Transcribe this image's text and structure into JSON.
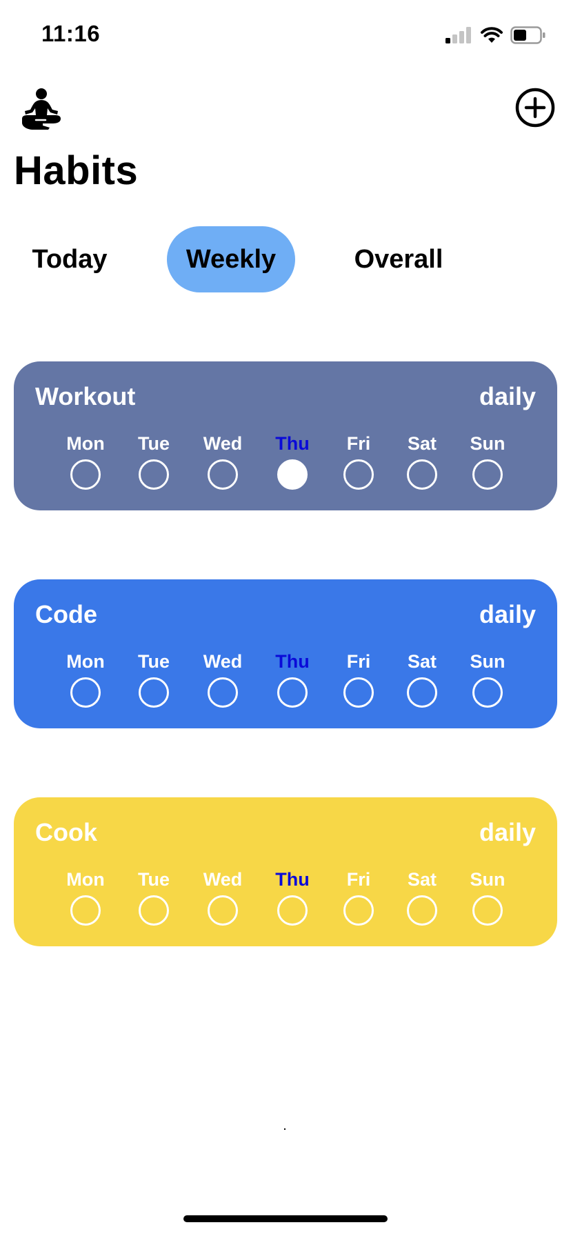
{
  "status_bar": {
    "time": "11:16"
  },
  "header": {
    "title": "Habits",
    "left_icon": "meditation-icon",
    "right_icon": "plus-circle-icon"
  },
  "tabs": [
    {
      "label": "Today",
      "selected": false
    },
    {
      "label": "Weekly",
      "selected": true
    },
    {
      "label": "Overall",
      "selected": false
    }
  ],
  "today_day": "Thu",
  "habits": [
    {
      "name": "Workout",
      "frequency": "daily",
      "color": "#6476a5",
      "days": [
        {
          "label": "Mon",
          "done": false
        },
        {
          "label": "Tue",
          "done": false
        },
        {
          "label": "Wed",
          "done": false
        },
        {
          "label": "Thu",
          "done": true
        },
        {
          "label": "Fri",
          "done": false
        },
        {
          "label": "Sat",
          "done": false
        },
        {
          "label": "Sun",
          "done": false
        }
      ]
    },
    {
      "name": "Code",
      "frequency": "daily",
      "color": "#3a78e8",
      "days": [
        {
          "label": "Mon",
          "done": false
        },
        {
          "label": "Tue",
          "done": false
        },
        {
          "label": "Wed",
          "done": false
        },
        {
          "label": "Thu",
          "done": false
        },
        {
          "label": "Fri",
          "done": false
        },
        {
          "label": "Sat",
          "done": false
        },
        {
          "label": "Sun",
          "done": false
        }
      ]
    },
    {
      "name": "Cook",
      "frequency": "daily",
      "color": "#f7d747",
      "days": [
        {
          "label": "Mon",
          "done": false
        },
        {
          "label": "Tue",
          "done": false
        },
        {
          "label": "Wed",
          "done": false
        },
        {
          "label": "Thu",
          "done": false
        },
        {
          "label": "Fri",
          "done": false
        },
        {
          "label": "Sat",
          "done": false
        },
        {
          "label": "Sun",
          "done": false
        }
      ]
    }
  ]
}
